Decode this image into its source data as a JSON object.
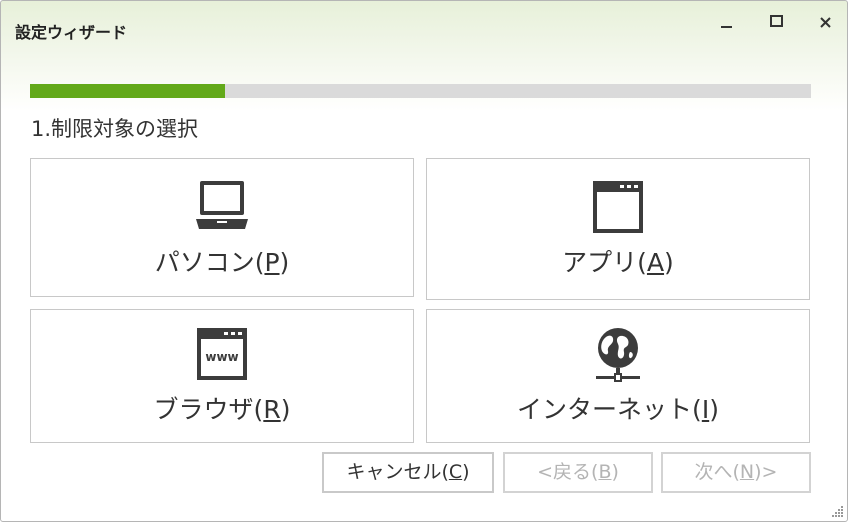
{
  "window": {
    "title": "設定ウィザード",
    "controls": {
      "minimize": "minimize",
      "maximize": "maximize",
      "close": "close"
    }
  },
  "progress": {
    "fraction": 0.25,
    "color": "#62a919"
  },
  "step_title": "1.制限対象の選択",
  "tiles": [
    {
      "pre": "パソコン(",
      "key": "P",
      "post": ")",
      "icon": "laptop-icon"
    },
    {
      "pre": "アプリ(",
      "key": "A",
      "post": ")",
      "icon": "app-window-icon"
    },
    {
      "pre": "ブラウザ(",
      "key": "R",
      "post": ")",
      "icon": "browser-www-icon"
    },
    {
      "pre": "インターネット(",
      "key": "I",
      "post": ")",
      "icon": "globe-network-icon"
    }
  ],
  "buttons": {
    "cancel": {
      "pre": "キャンセル(",
      "key": "C",
      "post": ")"
    },
    "back": {
      "pre": "<戻る(",
      "key": "B",
      "post": ")"
    },
    "next": {
      "pre": "次へ(",
      "key": "N",
      "post": ")>"
    }
  },
  "colors": {
    "accent": "#62a919",
    "icon": "#3c3c3c",
    "disabled_text": "#b4b4b4"
  }
}
